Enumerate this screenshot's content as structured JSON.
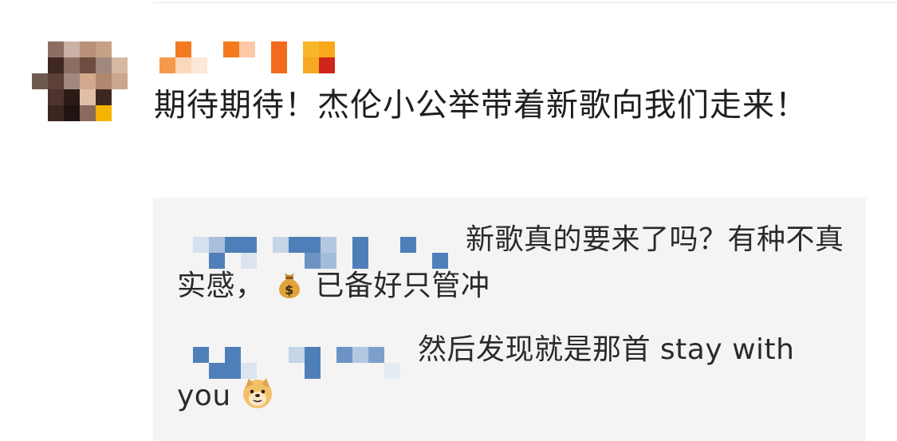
{
  "comment": {
    "username": "",
    "text": "期待期待！杰伦小公举带着新歌向我们走来！"
  },
  "replies": [
    {
      "username": "",
      "text_before_emoji": "新歌真的要来了吗？有种不真实感，",
      "emoji_icon": "money-bag-icon",
      "text_after_emoji": "已备好只管冲"
    },
    {
      "username": "",
      "text_before_emoji": "然后发现就是那首 stay with you",
      "emoji_icon": "doge-face-icon",
      "text_after_emoji": ""
    }
  ],
  "colors": {
    "reply_bg": "#f4f4f4",
    "username_blur_orange": "#f37a1f",
    "reply_username_blur_blue": "#4f7fb8"
  }
}
